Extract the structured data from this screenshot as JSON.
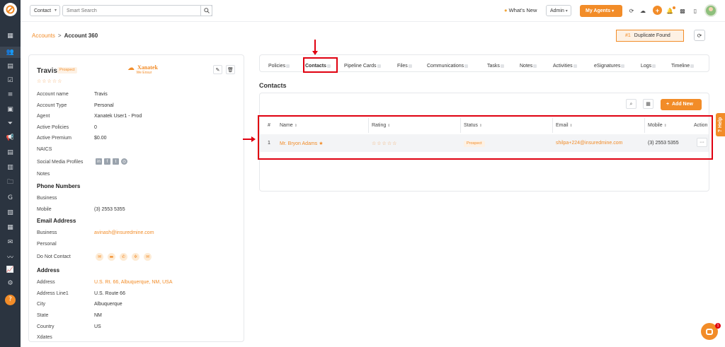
{
  "topbar": {
    "module_select": "Contact",
    "search_placeholder": "Smart Search",
    "whats_new": "What's New",
    "admin_label": "Admin",
    "my_agents_label": "My Agents"
  },
  "breadcrumb": {
    "parent": "Accounts",
    "separator": ">",
    "current": "Account 360"
  },
  "duplicate": {
    "number": "#1",
    "label": "Duplicate Found"
  },
  "profile": {
    "name": "Travis",
    "badge": "Prospect",
    "rating_stars": "☆☆☆☆☆",
    "agency_name": "Xanatek",
    "agency_tagline": "We Ensur",
    "fields": [
      {
        "label": "Account name",
        "value": "Travis"
      },
      {
        "label": "Account Type",
        "value": "Personal"
      },
      {
        "label": "Agent",
        "value": "Xanatek User1 - Prod"
      },
      {
        "label": "Active Policies",
        "value": "0"
      },
      {
        "label": "Active Premium",
        "value": "$0.00"
      },
      {
        "label": "NAICS",
        "value": ""
      },
      {
        "label": "Social Media Profiles",
        "value": ""
      },
      {
        "label": "Notes",
        "value": ""
      }
    ],
    "phone_section": "Phone Numbers",
    "phones": [
      {
        "label": "Business",
        "value": ""
      },
      {
        "label": "Mobile",
        "value": "(3) 2553 5355"
      }
    ],
    "email_section": "Email Address",
    "emails": [
      {
        "label": "Business",
        "value": "avinash@insuredmine.com"
      },
      {
        "label": "Personal",
        "value": ""
      }
    ],
    "do_not_contact_label": "Do Not Contact",
    "address_section": "Address",
    "address": [
      {
        "label": "Address",
        "value": "U.S. Rt. 66, Albuquerque, NM, USA"
      },
      {
        "label": "Address Line1",
        "value": "U.S. Route 66"
      },
      {
        "label": "City",
        "value": "Albuquerque"
      },
      {
        "label": "State",
        "value": "NM"
      },
      {
        "label": "Country",
        "value": "US"
      },
      {
        "label": "Xdates",
        "value": ""
      }
    ]
  },
  "tabs": [
    "Policies",
    "Contacts",
    "Pipeline Cards",
    "Files",
    "Communications",
    "Tasks",
    "Notes",
    "Activities",
    "eSignatures",
    "Logs",
    "Timeline"
  ],
  "active_tab": "Contacts",
  "contacts_section": {
    "title": "Contacts",
    "add_new_label": "Add New",
    "columns": [
      "#",
      "Name",
      "Rating",
      "Status",
      "Email",
      "Mobile",
      "Action"
    ],
    "rows": [
      {
        "index": "1",
        "name": "Mr. Bryon Adams",
        "rating": "☆☆☆☆☆",
        "status": "Prospect",
        "email": "shilpa+224@insuredmine.com",
        "mobile": "(3) 2553 5355",
        "action": "···"
      }
    ]
  },
  "help_label": "Help",
  "chat_badge": "1",
  "colors": {
    "accent": "#f28c28",
    "sidebar": "#2b3440",
    "annotation": "#e00010"
  }
}
